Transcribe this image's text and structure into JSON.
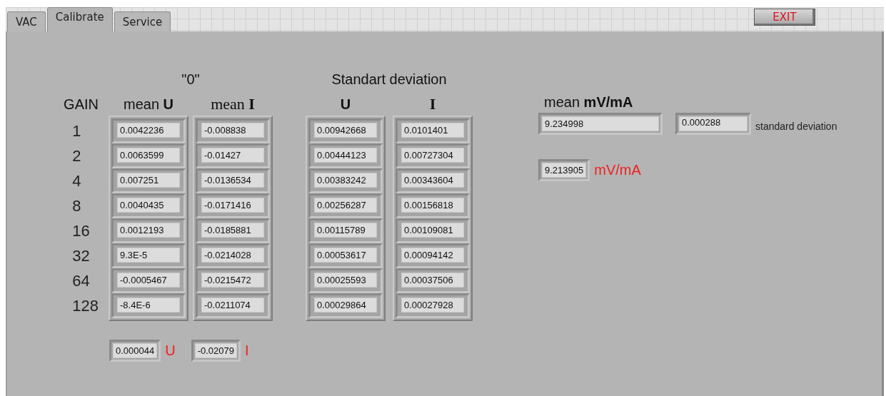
{
  "tabs": [
    {
      "label": "VAC",
      "selected": false
    },
    {
      "label": "Calibrate",
      "selected": true
    },
    {
      "label": "Service",
      "selected": false
    }
  ],
  "exit_button": "EXIT",
  "gain_header": "GAIN",
  "gains": [
    "1",
    "2",
    "4",
    "8",
    "16",
    "32",
    "64",
    "128"
  ],
  "zero_group": {
    "title": "\"0\"",
    "columns": [
      {
        "header": "mean **U**",
        "values": [
          "0.0042236",
          "0.0063599",
          "0.007251",
          "0.0040435",
          "0.0012193",
          "9.3E-5",
          "-0.0005467",
          "-8.4E-6"
        ]
      },
      {
        "header": "mean **I**",
        "values": [
          "-0.008838",
          "-0.01427",
          "-0.0136534",
          "-0.0171416",
          "-0.0185881",
          "-0.0214028",
          "-0.0215472",
          "-0.0211074"
        ]
      }
    ]
  },
  "deviation_group": {
    "title": "Standart deviation",
    "columns": [
      {
        "header": "U",
        "values": [
          "0.00942668",
          "0.00444123",
          "0.00383242",
          "0.00256287",
          "0.00115789",
          "0.00053617",
          "0.00025593",
          "0.00029864"
        ]
      },
      {
        "header": "I",
        "values": [
          "0.0101401",
          "0.00727304",
          "0.00343604",
          "0.00156818",
          "0.00109081",
          "0.00094142",
          "0.00037506",
          "0.00027928"
        ]
      }
    ]
  },
  "totals": [
    {
      "value": "0.000044",
      "unit": "U"
    },
    {
      "value": "-0.02079",
      "unit": "I"
    }
  ],
  "ratio": {
    "title": "mean **mV/mA**",
    "value": "9.234998",
    "std_value": "0.000288",
    "std_label": "standard deviation",
    "alt_value": "9.213905",
    "alt_unit": "mV/mA"
  }
}
